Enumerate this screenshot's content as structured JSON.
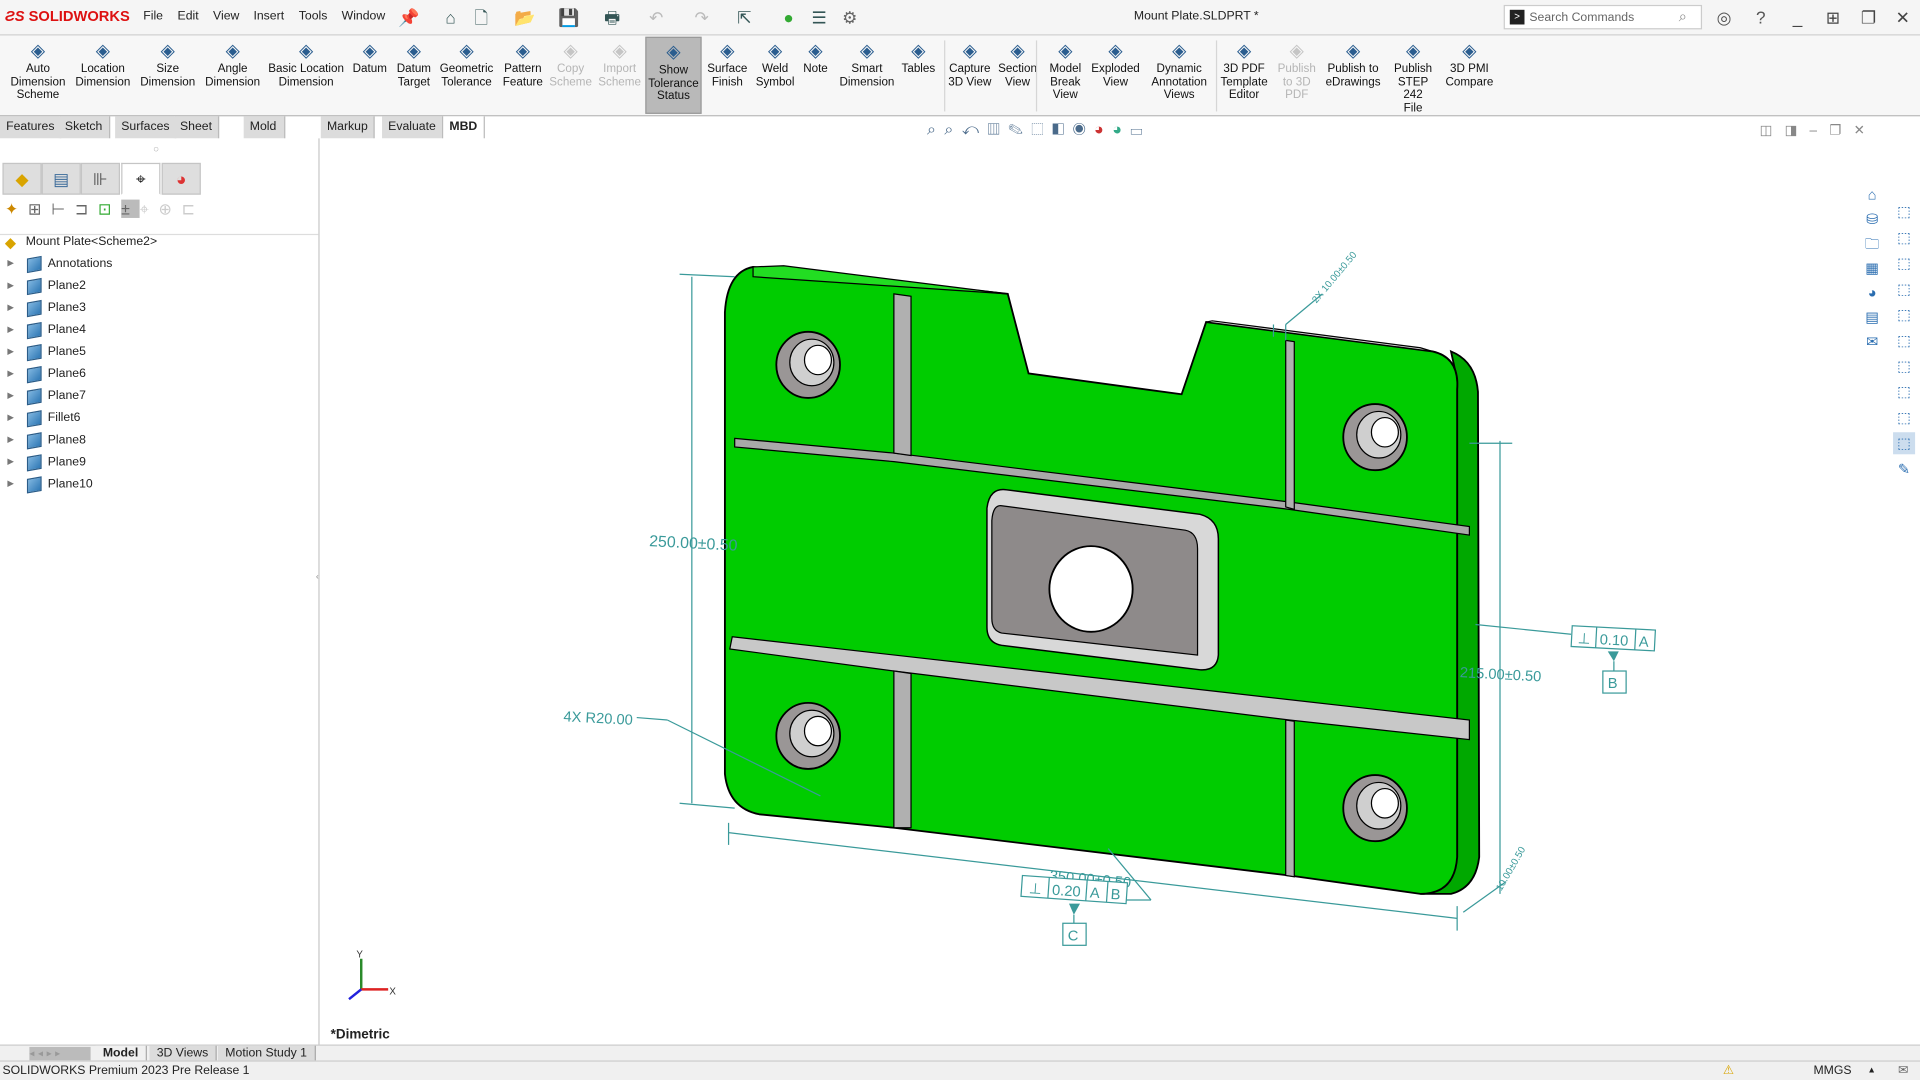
{
  "app": {
    "brand": "SOLIDWORKS",
    "document_title": "Mount Plate.SLDPRT *",
    "search_placeholder": "Search Commands"
  },
  "menu": [
    "File",
    "Edit",
    "View",
    "Insert",
    "Tools",
    "Window"
  ],
  "ribbon": [
    {
      "label": "Auto\nDimension\nScheme",
      "icon": "auto-dimension-icon"
    },
    {
      "label": "Location\nDimension",
      "icon": "location-dimension-icon"
    },
    {
      "label": "Size\nDimension",
      "icon": "size-dimension-icon"
    },
    {
      "label": "Angle\nDimension",
      "icon": "angle-dimension-icon"
    },
    {
      "label": "Basic Location\nDimension",
      "icon": "basic-location-dimension-icon"
    },
    {
      "label": "Datum",
      "icon": "datum-icon"
    },
    {
      "label": "Datum\nTarget",
      "icon": "datum-target-icon"
    },
    {
      "label": "Geometric\nTolerance",
      "icon": "geometric-tolerance-icon"
    },
    {
      "label": "Pattern\nFeature",
      "icon": "pattern-feature-icon"
    },
    {
      "label": "Copy\nScheme",
      "icon": "copy-scheme-icon",
      "disabled": true
    },
    {
      "label": "Import\nScheme",
      "icon": "import-scheme-icon",
      "disabled": true
    },
    {
      "label": "Show\nTolerance\nStatus",
      "icon": "show-tolerance-status-icon",
      "active": true
    },
    {
      "label": "Surface\nFinish",
      "icon": "surface-finish-icon"
    },
    {
      "label": "Weld\nSymbol",
      "icon": "weld-symbol-icon"
    },
    {
      "label": "Note",
      "icon": "note-icon"
    },
    {
      "label": "Smart\nDimension",
      "icon": "smart-dimension-icon"
    },
    {
      "label": "Tables",
      "icon": "tables-icon"
    },
    {
      "label": "Capture\n3D View",
      "icon": "capture-3d-view-icon"
    },
    {
      "label": "Section\nView",
      "icon": "section-view-icon"
    },
    {
      "label": "Model\nBreak\nView",
      "icon": "model-break-view-icon"
    },
    {
      "label": "Exploded\nView",
      "icon": "exploded-view-icon"
    },
    {
      "label": "Dynamic\nAnnotation\nViews",
      "icon": "dynamic-annotation-views-icon"
    },
    {
      "label": "3D PDF\nTemplate\nEditor",
      "icon": "3d-pdf-template-icon"
    },
    {
      "label": "Publish\nto 3D\nPDF",
      "icon": "publish-3d-pdf-icon",
      "disabled": true
    },
    {
      "label": "Publish to\neDrawings",
      "icon": "edrawings-icon"
    },
    {
      "label": "Publish\nSTEP 242\nFile",
      "icon": "step-242-icon"
    },
    {
      "label": "3D PMI\nCompare",
      "icon": "pmi-compare-icon"
    }
  ],
  "tabs": [
    {
      "label": "Features"
    },
    {
      "label": "Sketch"
    },
    {
      "label": "Surfaces"
    },
    {
      "label": "Sheet Metal"
    },
    {
      "label": "Mold Tools"
    },
    {
      "label": "Markup"
    },
    {
      "label": "Evaluate"
    },
    {
      "label": "MBD",
      "active": true
    }
  ],
  "tree": {
    "root": "Mount Plate<Scheme2>",
    "items": [
      {
        "label": "Annotations",
        "icon": "annotations-icon"
      },
      {
        "label": "Plane2",
        "icon": "plane-icon"
      },
      {
        "label": "Plane3",
        "icon": "plane-icon"
      },
      {
        "label": "Plane4",
        "icon": "plane-icon"
      },
      {
        "label": "Plane5",
        "icon": "plane-icon"
      },
      {
        "label": "Plane6",
        "icon": "plane-icon"
      },
      {
        "label": "Plane7",
        "icon": "plane-icon"
      },
      {
        "label": "Fillet6",
        "icon": "fillet-icon"
      },
      {
        "label": "Plane8",
        "icon": "plane-icon"
      },
      {
        "label": "Plane9",
        "icon": "plane-icon"
      },
      {
        "label": "Plane10",
        "icon": "plane-icon"
      }
    ]
  },
  "viewport": {
    "view_name": "*Dimetric",
    "model_color": "#00cc00",
    "annotation_color": "#3a9a9a",
    "dimensions": {
      "height": "250.00±0.50",
      "width": "350.00±0.50",
      "right_height": "215.00±0.50",
      "radius": "4X R20.00",
      "hole_top": "2X 10.00±0.50",
      "depth": "10.00±0.50"
    },
    "fcf_bottom": {
      "symbol": "⊥",
      "tolerance": "0.20",
      "datums": [
        "A",
        "B"
      ],
      "datum_label": "C"
    },
    "fcf_right": {
      "symbol": "⊥",
      "tolerance": "0.10",
      "datums": [
        "A"
      ],
      "datum_label": "B"
    },
    "triad": {
      "x": "X",
      "y": "Y"
    }
  },
  "bottom_tabs": [
    {
      "label": "Model",
      "active": true
    },
    {
      "label": "3D Views"
    },
    {
      "label": "Motion Study 1"
    }
  ],
  "status": {
    "text": "SOLIDWORKS Premium 2023 Pre Release 1",
    "units": "MMGS"
  }
}
